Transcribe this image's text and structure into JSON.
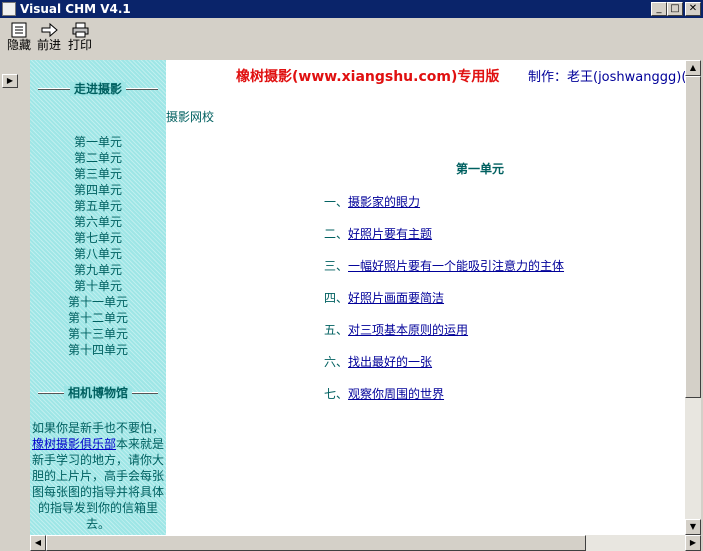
{
  "window": {
    "title": "Visual CHM V4.1"
  },
  "toolbar": {
    "hide_label": "隐藏",
    "forward_label": "前进",
    "print_label": "打印"
  },
  "sidebar": {
    "section1_title": "走进摄影",
    "units": [
      "第一单元",
      "第二单元",
      "第三单元",
      "第四单元",
      "第五单元",
      "第六单元",
      "第七单元",
      "第八单元",
      "第九单元",
      "第十单元",
      "第十一单元",
      "第十二单元",
      "第十三单元",
      "第十四单元"
    ],
    "section2_title": "相机博物馆",
    "desc_line1": "如果你是新手也不要怕，",
    "desc_link": "橡树摄影俱乐部",
    "desc_line2_rest": "本来就是",
    "desc_line3": "新手学习的地方，请你大",
    "desc_line4": "胆的上片片，高手会每张",
    "desc_line5": "图每张图的指导并将具体",
    "desc_line6": "的指导发到你的信箱里",
    "desc_line7": "去。"
  },
  "content": {
    "banner": "橡树摄影(www.xiangshu.com)专用版",
    "maker": "制作：老王(joshwanggg)(",
    "school": "摄影网校",
    "unit_title": "第一单元",
    "toc": [
      {
        "num": "一、",
        "label": "摄影家的眼力"
      },
      {
        "num": "二、",
        "label": "好照片要有主题"
      },
      {
        "num": "三、",
        "label": "一幅好照片要有一个能吸引注意力的主体"
      },
      {
        "num": "四、",
        "label": "好照片画面要简洁"
      },
      {
        "num": "五、",
        "label": "对三项基本原则的运用"
      },
      {
        "num": "六、",
        "label": "找出最好的一张"
      },
      {
        "num": "七、",
        "label": "观察你周围的世界"
      }
    ]
  },
  "icons": [
    "app-icon",
    "hide-icon",
    "forward-icon",
    "print-icon",
    "minimize-icon",
    "maximize-icon",
    "close-icon",
    "arrow-up-icon",
    "arrow-down-icon",
    "arrow-left-icon",
    "arrow-right-icon"
  ]
}
